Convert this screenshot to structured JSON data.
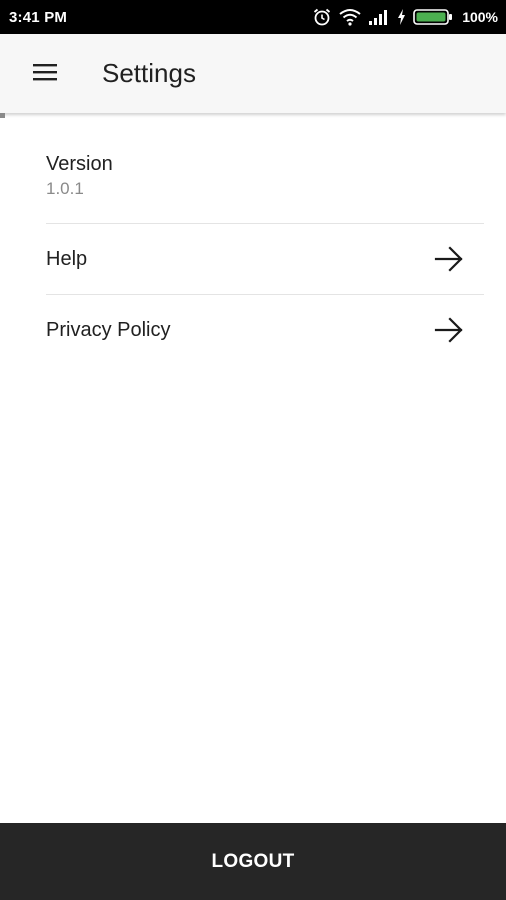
{
  "status_bar": {
    "time": "3:41 PM",
    "battery_percent": "100%",
    "icons": [
      "alarm-icon",
      "wifi-icon",
      "signal-icon",
      "charging-icon",
      "battery-icon"
    ],
    "battery_level": 1.0,
    "battery_color": "#4caf50"
  },
  "app_bar": {
    "menu_icon": "hamburger-menu-icon",
    "title": "Settings"
  },
  "settings": {
    "version": {
      "label": "Version",
      "value": "1.0.1"
    },
    "items": [
      {
        "label": "Help",
        "icon": "arrow-right-icon"
      },
      {
        "label": "Privacy Policy",
        "icon": "arrow-right-icon"
      }
    ]
  },
  "footer": {
    "logout_label": "LOGOUT"
  },
  "colors": {
    "status_bar_bg": "#000000",
    "app_bar_bg": "#f7f7f7",
    "logout_bar_bg": "#262626",
    "secondary_text": "#8a8a8a"
  }
}
